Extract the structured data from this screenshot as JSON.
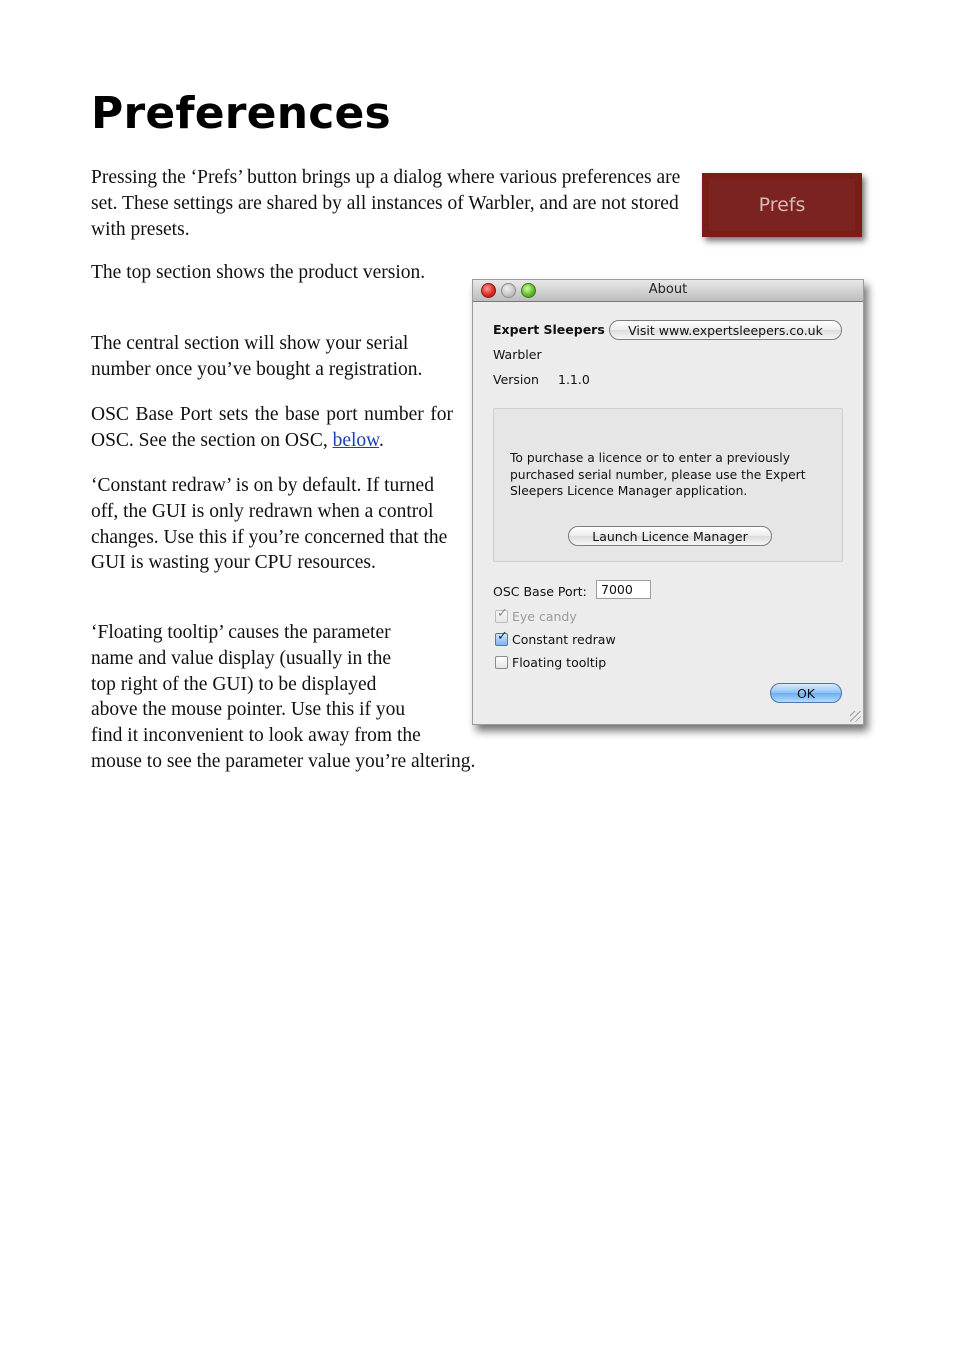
{
  "page": {
    "title": "Preferences",
    "paragraphs": {
      "intro": "Pressing the ‘Prefs’ button brings up a dialog where various preferences are set. These settings are shared by all instances of Warbler, and are not stored with presets.",
      "top_section": "The top section shows the product version.",
      "central_section": "The central section will show your serial number once you’ve bought a registration.",
      "osc_before_link": "OSC Base Port sets the base port number for OSC. See the section on OSC, ",
      "osc_link": "below",
      "osc_after_link": ".",
      "constant_redraw": "‘Constant redraw’ is on by default. If turned off, the GUI is only redrawn when a control changes. Use this if you’re concerned that the GUI is wasting your CPU resources.",
      "floating_tooltip_lines": [
        "‘Floating tooltip’ causes the parameter",
        "name and value display (usually in the",
        "top right of the GUI) to be displayed",
        "above the mouse pointer. Use this if you",
        "find it inconvenient to look away from the",
        "mouse to see the parameter value you’re altering."
      ]
    }
  },
  "prefs_button": {
    "label": "Prefs",
    "color": "#7c1c17"
  },
  "dialog": {
    "title": "About",
    "company": "Expert Sleepers",
    "visit_button": "Visit www.expertsleepers.co.uk",
    "product": "Warbler",
    "version_label": "Version",
    "version_value": "1.1.0",
    "licence_text": "To purchase a licence or to enter a previously purchased serial number, please use the Expert Sleepers Licence Manager application.",
    "launch_button": "Launch Licence Manager",
    "osc_label": "OSC Base Port:",
    "osc_value": "7000",
    "checkboxes": [
      {
        "label": "Eye candy",
        "checked": true,
        "disabled": true
      },
      {
        "label": "Constant redraw",
        "checked": true,
        "disabled": false
      },
      {
        "label": "Floating tooltip",
        "checked": false,
        "disabled": false
      }
    ],
    "ok_button": "OK"
  }
}
